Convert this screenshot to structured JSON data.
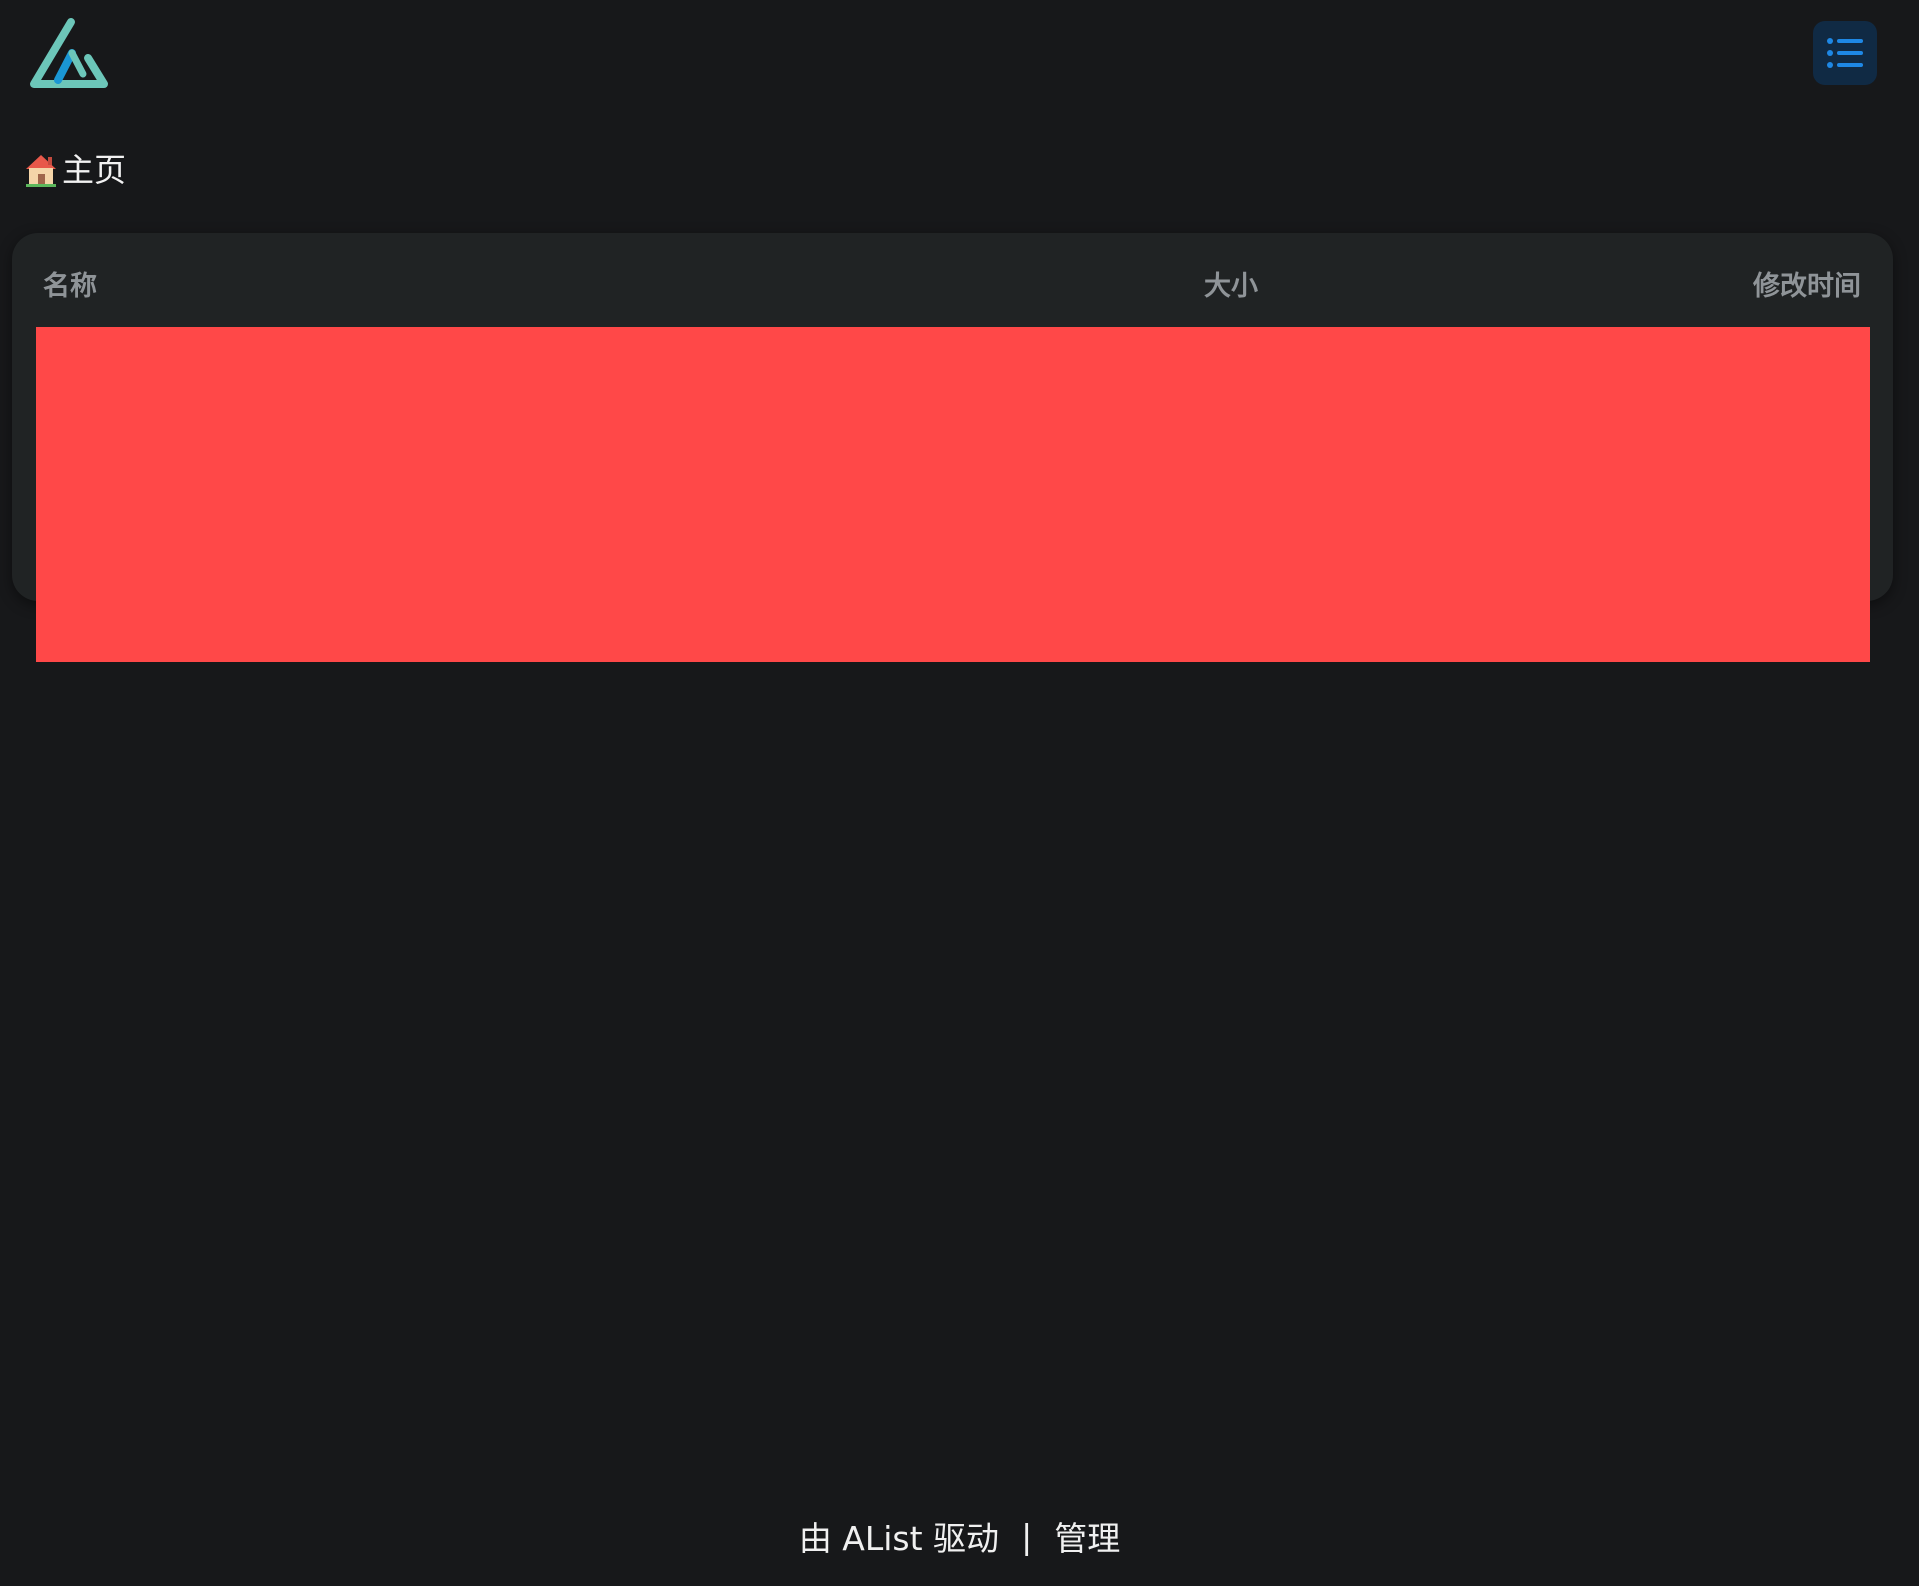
{
  "header": {
    "logo_icon": "alist-logo-icon",
    "menu_icon": "list-menu-icon",
    "accent": "#1e88e5",
    "logo_colors": [
      "#6cc6b9",
      "#1a96d4"
    ]
  },
  "breadcrumb": {
    "icon": "house-emoji-icon",
    "label": "主页"
  },
  "table": {
    "columns": {
      "name": "名称",
      "size": "大小",
      "modified": "修改时间"
    }
  },
  "redaction": {
    "color": "#ff4848"
  },
  "footer": {
    "powered_by": "由 AList 驱动",
    "separator": "|",
    "manage": "管理"
  }
}
